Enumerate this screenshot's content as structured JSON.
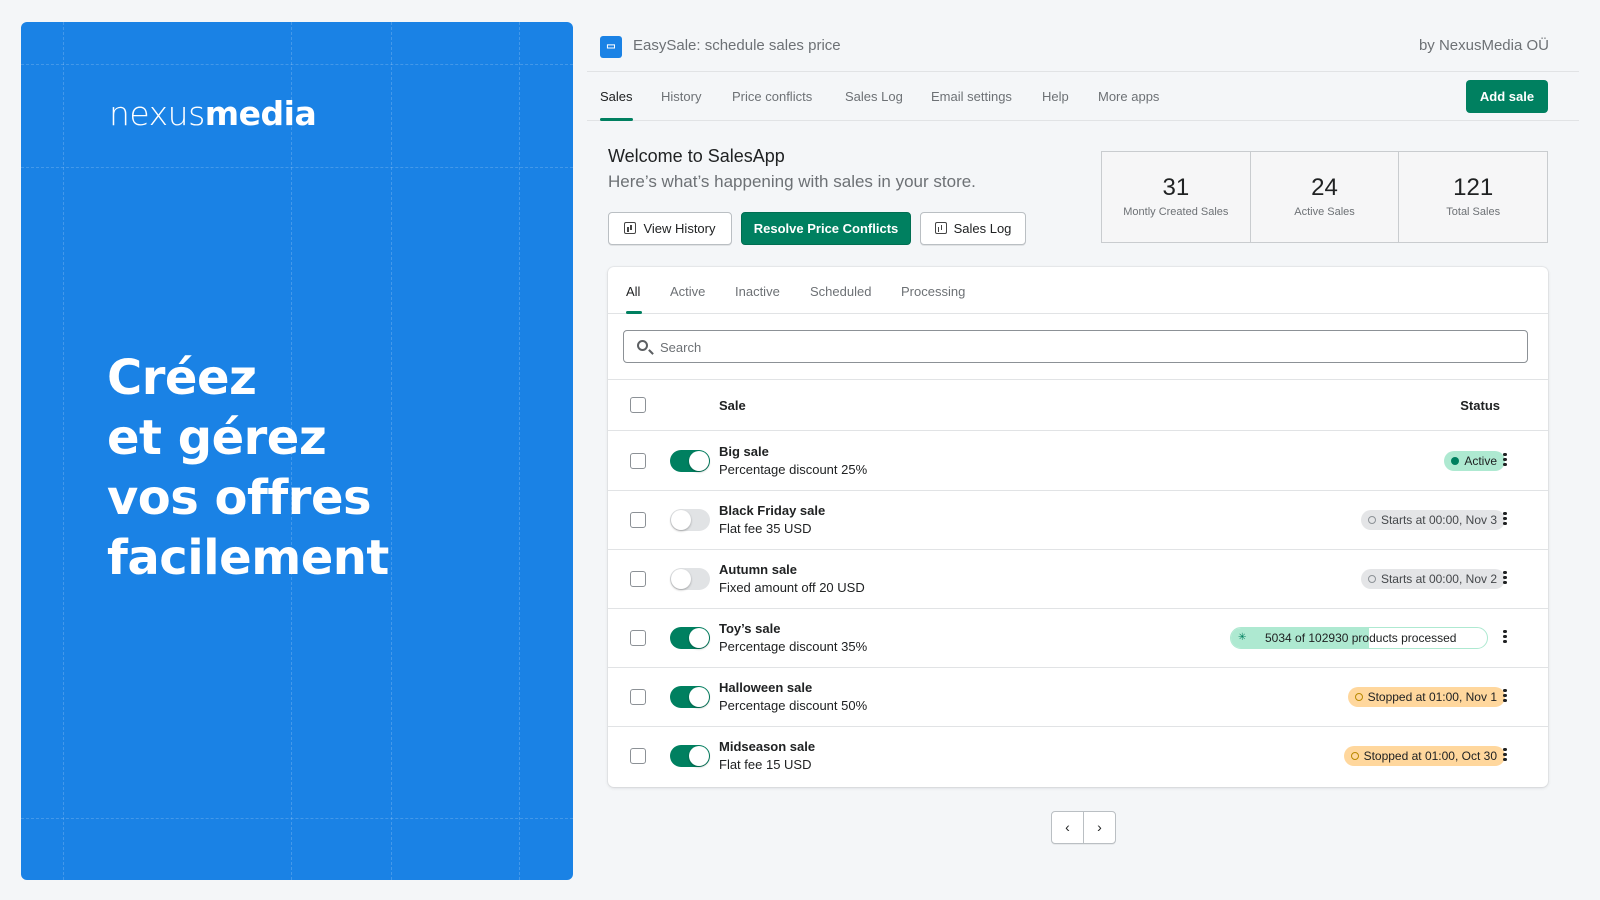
{
  "promo": {
    "logo_light": "nexus",
    "logo_bold": "media",
    "headline": [
      "Créez",
      "et gérez",
      "vos offres",
      "facilement"
    ],
    "background": "#1a82e5"
  },
  "app": {
    "icon": "ticket-icon",
    "title": "EasySale: schedule sales price",
    "by": "by NexusMedia OÜ"
  },
  "nav": {
    "tabs": [
      "Sales",
      "History",
      "Price conflicts",
      "Sales Log",
      "Email settings",
      "Help",
      "More apps"
    ],
    "active": "Sales",
    "add_sale": "Add sale"
  },
  "welcome": {
    "title": "Welcome to SalesApp",
    "subtitle": "Here’s what’s happening with sales in your store.",
    "view_history": "View History",
    "resolve_conflicts": "Resolve Price Conflicts",
    "sales_log": "Sales Log"
  },
  "stats": [
    {
      "value": "31",
      "label": "Montly Created Sales"
    },
    {
      "value": "24",
      "label": "Active Sales"
    },
    {
      "value": "121",
      "label": "Total Sales"
    }
  ],
  "filters": {
    "tabs": [
      "All",
      "Active",
      "Inactive",
      "Scheduled",
      "Processing"
    ],
    "active": "All"
  },
  "search": {
    "placeholder": "Search"
  },
  "table": {
    "col_sale": "Sale",
    "col_status": "Status",
    "rows": [
      {
        "name": "Big sale",
        "desc": "Percentage discount 25%",
        "enabled": true,
        "status_type": "active",
        "status": "Active"
      },
      {
        "name": "Black Friday sale",
        "desc": "Flat fee 35 USD",
        "enabled": false,
        "status_type": "scheduled",
        "status": "Starts at 00:00, Nov 3"
      },
      {
        "name": "Autumn sale",
        "desc": "Fixed amount off 20 USD",
        "enabled": false,
        "status_type": "scheduled",
        "status": "Starts at 00:00, Nov 2"
      },
      {
        "name": "Toy’s sale",
        "desc": "Percentage discount 35%",
        "enabled": true,
        "status_type": "processing",
        "status": "5034 of 102930 products processed",
        "progress": 0.54
      },
      {
        "name": "Halloween sale",
        "desc": "Percentage discount 50%",
        "enabled": true,
        "status_type": "stopped",
        "status": "Stopped at 01:00, Nov 1"
      },
      {
        "name": "Midseason sale",
        "desc": "Flat fee 15 USD",
        "enabled": true,
        "status_type": "stopped",
        "status": "Stopped at 01:00, Oct 30"
      }
    ]
  },
  "pagination": {
    "prev": "‹",
    "next": "›"
  },
  "colors": {
    "accent": "#008060",
    "active_badge": "#aee9d1",
    "stopped_badge": "#ffd79d",
    "scheduled_badge": "#e4e5e7"
  }
}
